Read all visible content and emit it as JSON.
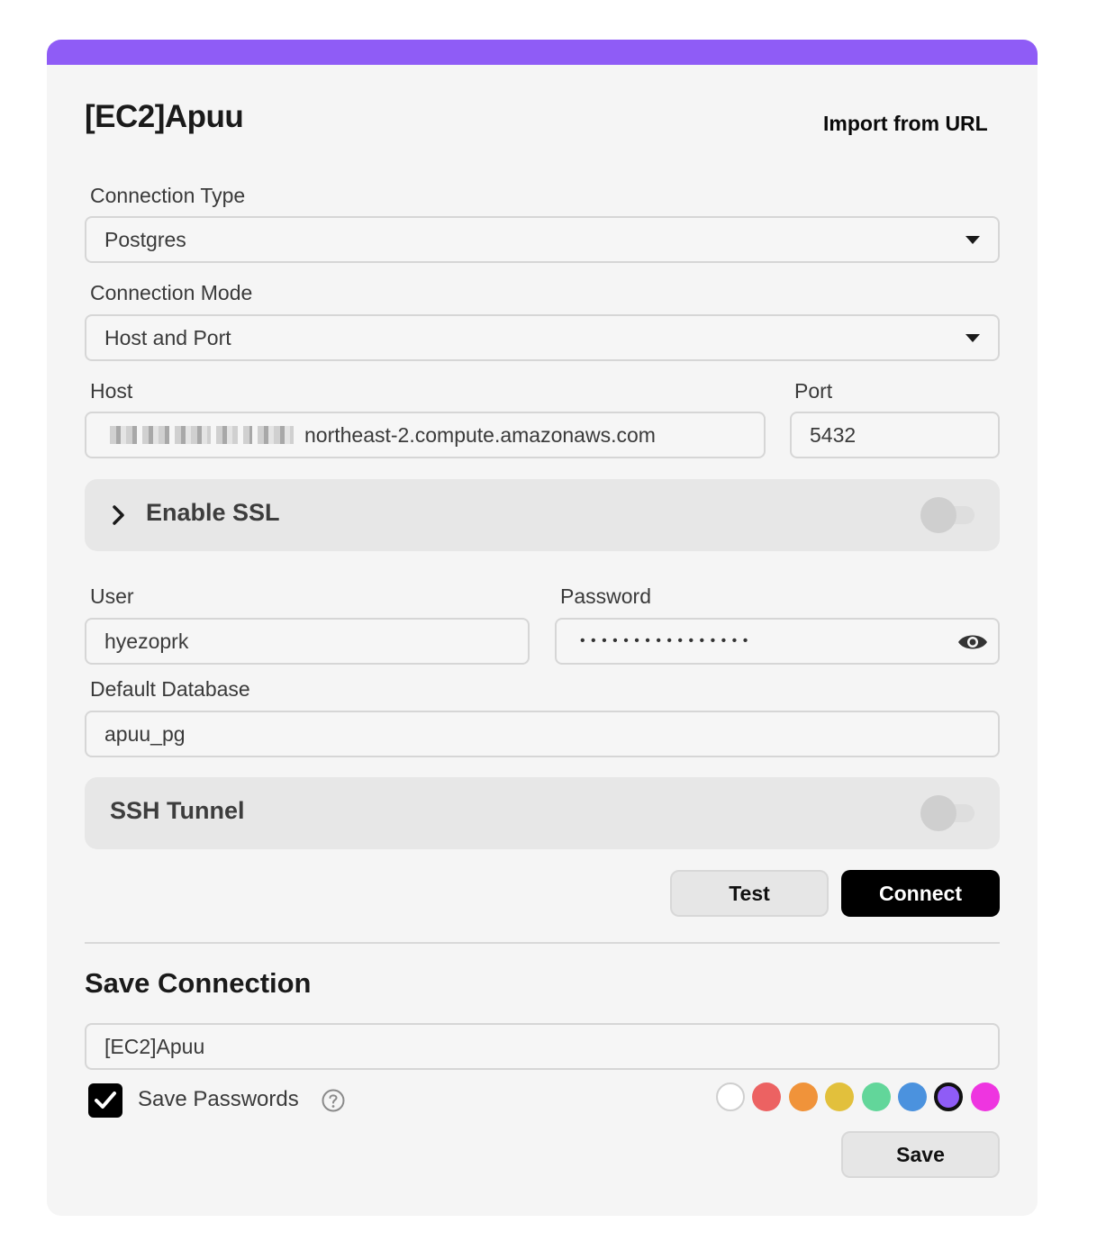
{
  "dialog": {
    "title": "[EC2]Apuu",
    "import_link": "Import from URL"
  },
  "connection_type": {
    "label": "Connection Type",
    "value": "Postgres"
  },
  "connection_mode": {
    "label": "Connection Mode",
    "value": "Host and Port"
  },
  "host": {
    "label": "Host",
    "value": "northeast-2.compute.amazonaws.com"
  },
  "port": {
    "label": "Port",
    "value": "5432"
  },
  "ssl": {
    "title": "Enable SSL",
    "enabled": false
  },
  "user": {
    "label": "User",
    "value": "hyezoprk"
  },
  "password": {
    "label": "Password",
    "masked": "• • • • • • • • • • • • • • • •"
  },
  "default_database": {
    "label": "Default Database",
    "value": "apuu_pg"
  },
  "ssh": {
    "title": "SSH Tunnel",
    "enabled": false
  },
  "actions": {
    "test_label": "Test",
    "connect_label": "Connect"
  },
  "save_connection": {
    "heading": "Save Connection",
    "name_value": "[EC2]Apuu",
    "save_passwords_label": "Save Passwords",
    "save_passwords_checked": true,
    "save_label": "Save",
    "colors": [
      "#ffffff",
      "#ec6262",
      "#f0933a",
      "#e2c03c",
      "#62d69a",
      "#4b92de",
      "#8f5cf6",
      "#ee35e0"
    ],
    "selected_color": "#8f5cf6"
  },
  "icons": [
    "chevron-right-icon",
    "caret-down-icon",
    "eye-icon",
    "help-icon",
    "checkmark-icon"
  ]
}
